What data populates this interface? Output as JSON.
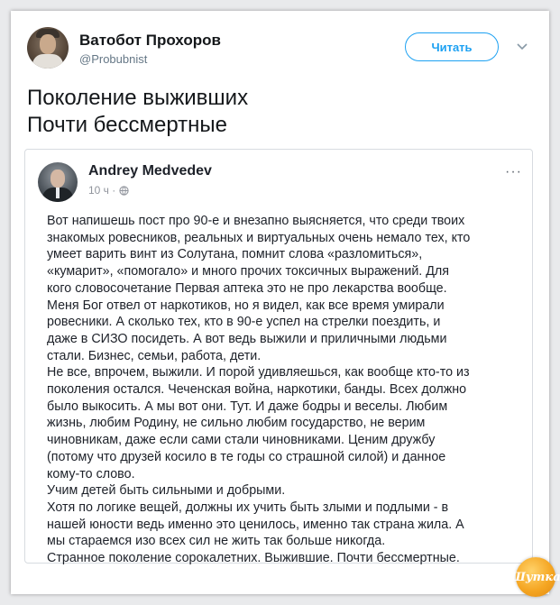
{
  "tweet": {
    "author_name": "Ватобот Прохоров",
    "author_handle": "@Probubnist",
    "follow_label": "Читать",
    "text_lines": [
      "Поколение выживших",
      "Почти бессмертные"
    ]
  },
  "embedded_post": {
    "author_name": "Andrey Medvedev",
    "time": "10 ч ·",
    "menu_label": "···",
    "body_lines": [
      "Вот напишешь пост про 90-е и внезапно выясняется, что среди твоих",
      "знакомых ровесников, реальных и виртуальных очень немало тех, кто",
      "умеет варить винт из Солутана, помнит слова  «разломиться»,",
      "«кумарит», «помогало» и много прочих токсичных выражений. Для",
      "кого словосочетание Первая аптека это не про лекарства вообще.",
      "Меня Бог отвел от наркотиков, но я видел, как все время умирали",
      "ровесники. А сколько тех, кто в 90-е успел на стрелки поездить, и",
      "даже в СИЗО посидеть. А вот ведь выжили и приличными людьми",
      "стали. Бизнес, семьи, работа, дети.",
      "Не все, впрочем, выжили. И порой удивляешься, как вообще кто-то из",
      "поколения остался. Чеченская война, наркотики, банды. Всех должно",
      "было выкосить. А мы вот они. Тут. И даже бодры и веселы. Любим",
      "жизнь, любим Родину, не сильно любим государство, не верим",
      "чиновникам, даже если сами стали чиновниками. Ценим дружбу",
      "(потому что друзей косило в те годы со страшной силой) и данное",
      "кому-то слово.",
      "Учим детей быть сильными и добрыми.",
      "Хотя по логике вещей, должны их учить быть злыми и подлыми - в",
      "нашей юности ведь именно это ценилось, именно так страна жила. А",
      "мы стараемся изо всех сил не жить так больше никогда.",
      "Странное поколение сорокалетних. Выжившие. Почти бессмертные."
    ]
  },
  "watermark": {
    "text": "Шутка"
  },
  "colors": {
    "accent": "#1da1f2",
    "watermark": "#f5a623"
  }
}
